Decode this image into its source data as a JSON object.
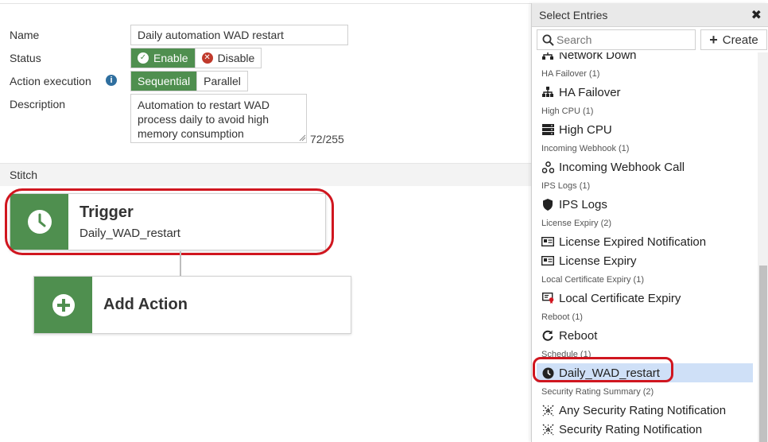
{
  "form": {
    "name_label": "Name",
    "name_value": "Daily automation WAD restart",
    "status_label": "Status",
    "status_options": [
      "Enable",
      "Disable"
    ],
    "status_selected": "Enable",
    "action_execution_label": "Action execution",
    "execution_options": [
      "Sequential",
      "Parallel"
    ],
    "execution_selected": "Sequential",
    "description_label": "Description",
    "description_value": "Automation to restart WAD process daily to avoid high memory consumption",
    "char_count": "72/255"
  },
  "stitch": {
    "section_title": "Stitch",
    "trigger": {
      "title": "Trigger",
      "value": "Daily_WAD_restart",
      "icon": "clock-icon"
    },
    "add_action": {
      "title": "Add Action",
      "icon": "plus-circle-icon"
    }
  },
  "panel": {
    "title": "Select Entries",
    "search_placeholder": "Search",
    "create_label": "Create",
    "partial_entry": "Network Down",
    "groups": [
      {
        "label": "HA Failover (1)",
        "entries": [
          {
            "label": "HA Failover",
            "icon": "network-icon"
          }
        ]
      },
      {
        "label": "High CPU (1)",
        "entries": [
          {
            "label": "High CPU",
            "icon": "server-icon"
          }
        ]
      },
      {
        "label": "Incoming Webhook (1)",
        "entries": [
          {
            "label": "Incoming Webhook Call",
            "icon": "webhook-icon"
          }
        ]
      },
      {
        "label": "IPS Logs (1)",
        "entries": [
          {
            "label": "IPS Logs",
            "icon": "shield-icon"
          }
        ]
      },
      {
        "label": "License Expiry (2)",
        "entries": [
          {
            "label": "License Expired Notification",
            "icon": "id-card-icon"
          },
          {
            "label": "License Expiry",
            "icon": "id-card-icon"
          }
        ]
      },
      {
        "label": "Local Certificate Expiry (1)",
        "entries": [
          {
            "label": "Local Certificate Expiry",
            "icon": "certificate-icon"
          }
        ]
      },
      {
        "label": "Reboot (1)",
        "entries": [
          {
            "label": "Reboot",
            "icon": "reboot-icon"
          }
        ]
      },
      {
        "label": "Schedule (1)",
        "entries": [
          {
            "label": "Daily_WAD_restart",
            "icon": "clock-icon",
            "selected": true
          }
        ]
      },
      {
        "label": "Security Rating Summary (2)",
        "entries": [
          {
            "label": "Any Security Rating Notification",
            "icon": "security-rating-icon"
          },
          {
            "label": "Security Rating Notification",
            "icon": "security-rating-icon"
          }
        ]
      }
    ]
  },
  "colors": {
    "accent_green": "#4f8f4f",
    "highlight_red": "#d0161f",
    "selected_row": "#cfe0f7"
  }
}
